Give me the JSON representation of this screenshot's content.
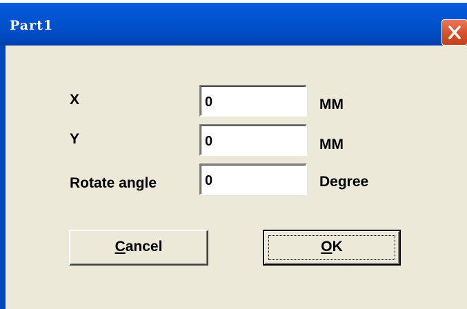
{
  "window": {
    "title": "Part1",
    "close_icon": "close-x-icon",
    "colors": {
      "titlebar": "#0152cd",
      "body": "#ece9d8",
      "close_button": "#d8522e"
    }
  },
  "fields": {
    "x": {
      "label": "X",
      "value": "0",
      "unit": "MM"
    },
    "y": {
      "label": "Y",
      "value": "0",
      "unit": "MM"
    },
    "rotate": {
      "label": "Rotate angle",
      "value": "0",
      "unit": "Degree"
    }
  },
  "buttons": {
    "cancel": {
      "mnemonic": "C",
      "rest": "ancel"
    },
    "ok": {
      "mnemonic": "O",
      "rest": "K"
    }
  }
}
